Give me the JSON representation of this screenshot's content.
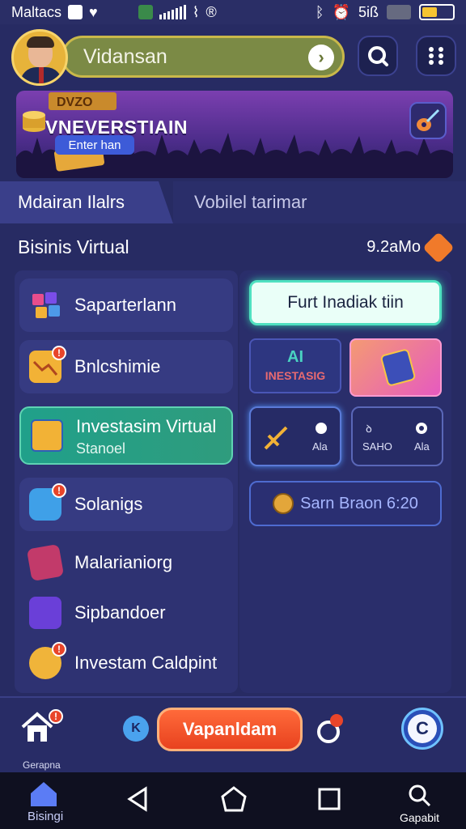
{
  "status_bar": {
    "carrier": "Maltacs",
    "network": "5iß"
  },
  "header": {
    "username": "Vidansan",
    "go_icon": "chevron-right-icon",
    "search_icon": "search-icon",
    "menu_icon": "grid-menu-icon"
  },
  "banner": {
    "title": "VNEVERSTIAIN",
    "subtitle": "Enter han",
    "top_text": "DVZO"
  },
  "tabs": [
    {
      "label": "Mdairan Ilalrs",
      "active": true
    },
    {
      "label": "Vobilel tarimar",
      "active": false
    }
  ],
  "section": {
    "title": "Bisinis Virtual",
    "count": "9.2aMo"
  },
  "menu": [
    {
      "label": "Saparterlann",
      "icon": "cubes-icon"
    },
    {
      "label": "Bnlcshimie",
      "icon": "chart-icon",
      "badge": "!"
    },
    {
      "label": "Solanigs",
      "icon": "box-icon",
      "badge": "!"
    },
    {
      "label": "Malarianiorg",
      "icon": "book-icon"
    },
    {
      "label": "Sipbandoer",
      "icon": "cube-icon"
    },
    {
      "label": "Investam Caldpint",
      "icon": "coin-icon",
      "badge": "!"
    }
  ],
  "active_menu": {
    "title": "Investasim Virtual",
    "subtitle": "Stanoel"
  },
  "right_panel": {
    "primary_button": "Furt Inadiak tiin",
    "ai_card": {
      "line1": "AI",
      "line2": "INESTASIG"
    },
    "glow_card_1": {
      "label": "Ala"
    },
    "glow_card_2": {
      "top": "ꝺ",
      "label_left": "SAHO",
      "label_right": "Ala"
    },
    "sarn_button": "Sarn Braon 6:20"
  },
  "bottom_bar": {
    "home_label": "Gerapna",
    "cta_label": "Vapanldam",
    "k_label": "K",
    "c_label": "C"
  },
  "nav": {
    "home_label": "Bisingi",
    "search_label": "Gapabit"
  }
}
